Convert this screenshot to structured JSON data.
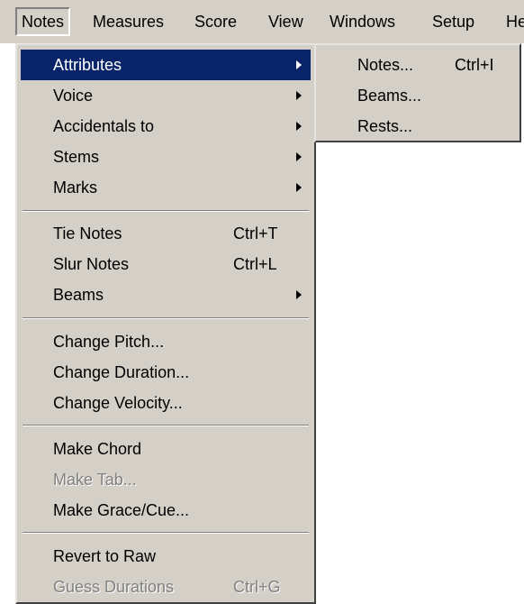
{
  "menubar": {
    "items": [
      "Notes",
      "Measures",
      "Score",
      "View",
      "Windows",
      "Setup",
      "He"
    ]
  },
  "notes_menu": {
    "attributes": "Attributes",
    "voice": "Voice",
    "accidentals_to": "Accidentals to",
    "stems": "Stems",
    "marks": "Marks",
    "tie_notes": "Tie Notes",
    "tie_notes_shortcut": "Ctrl+T",
    "slur_notes": "Slur Notes",
    "slur_notes_shortcut": "Ctrl+L",
    "beams": "Beams",
    "change_pitch": "Change Pitch...",
    "change_duration": "Change Duration...",
    "change_velocity": "Change Velocity...",
    "make_chord": "Make Chord",
    "make_tab": "Make Tab...",
    "make_grace_cue": "Make Grace/Cue...",
    "revert_to_raw": "Revert to Raw",
    "guess_durations": "Guess Durations",
    "guess_durations_shortcut": "Ctrl+G"
  },
  "attributes_submenu": {
    "notes": "Notes...",
    "notes_shortcut": "Ctrl+I",
    "beams": "Beams...",
    "rests": "Rests..."
  }
}
